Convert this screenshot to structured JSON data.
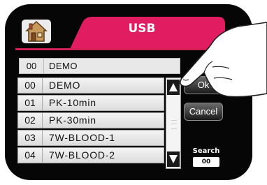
{
  "header": {
    "home_icon": "home-icon",
    "tab_label": "USB"
  },
  "selected": {
    "number": "00",
    "name": "DEMO"
  },
  "list": [
    {
      "number": "00",
      "name": "DEMO"
    },
    {
      "number": "01",
      "name": "PK-10min"
    },
    {
      "number": "02",
      "name": "PK-30min"
    },
    {
      "number": "03",
      "name": "7W-BLOOD-1"
    },
    {
      "number": "04",
      "name": "7W-BLOOD-2"
    }
  ],
  "buttons": {
    "ok": "Ok",
    "cancel": "Cancel"
  },
  "search": {
    "label": "Search",
    "value": "00"
  },
  "colors": {
    "accent": "#e21c60",
    "bezel": "#060606"
  }
}
